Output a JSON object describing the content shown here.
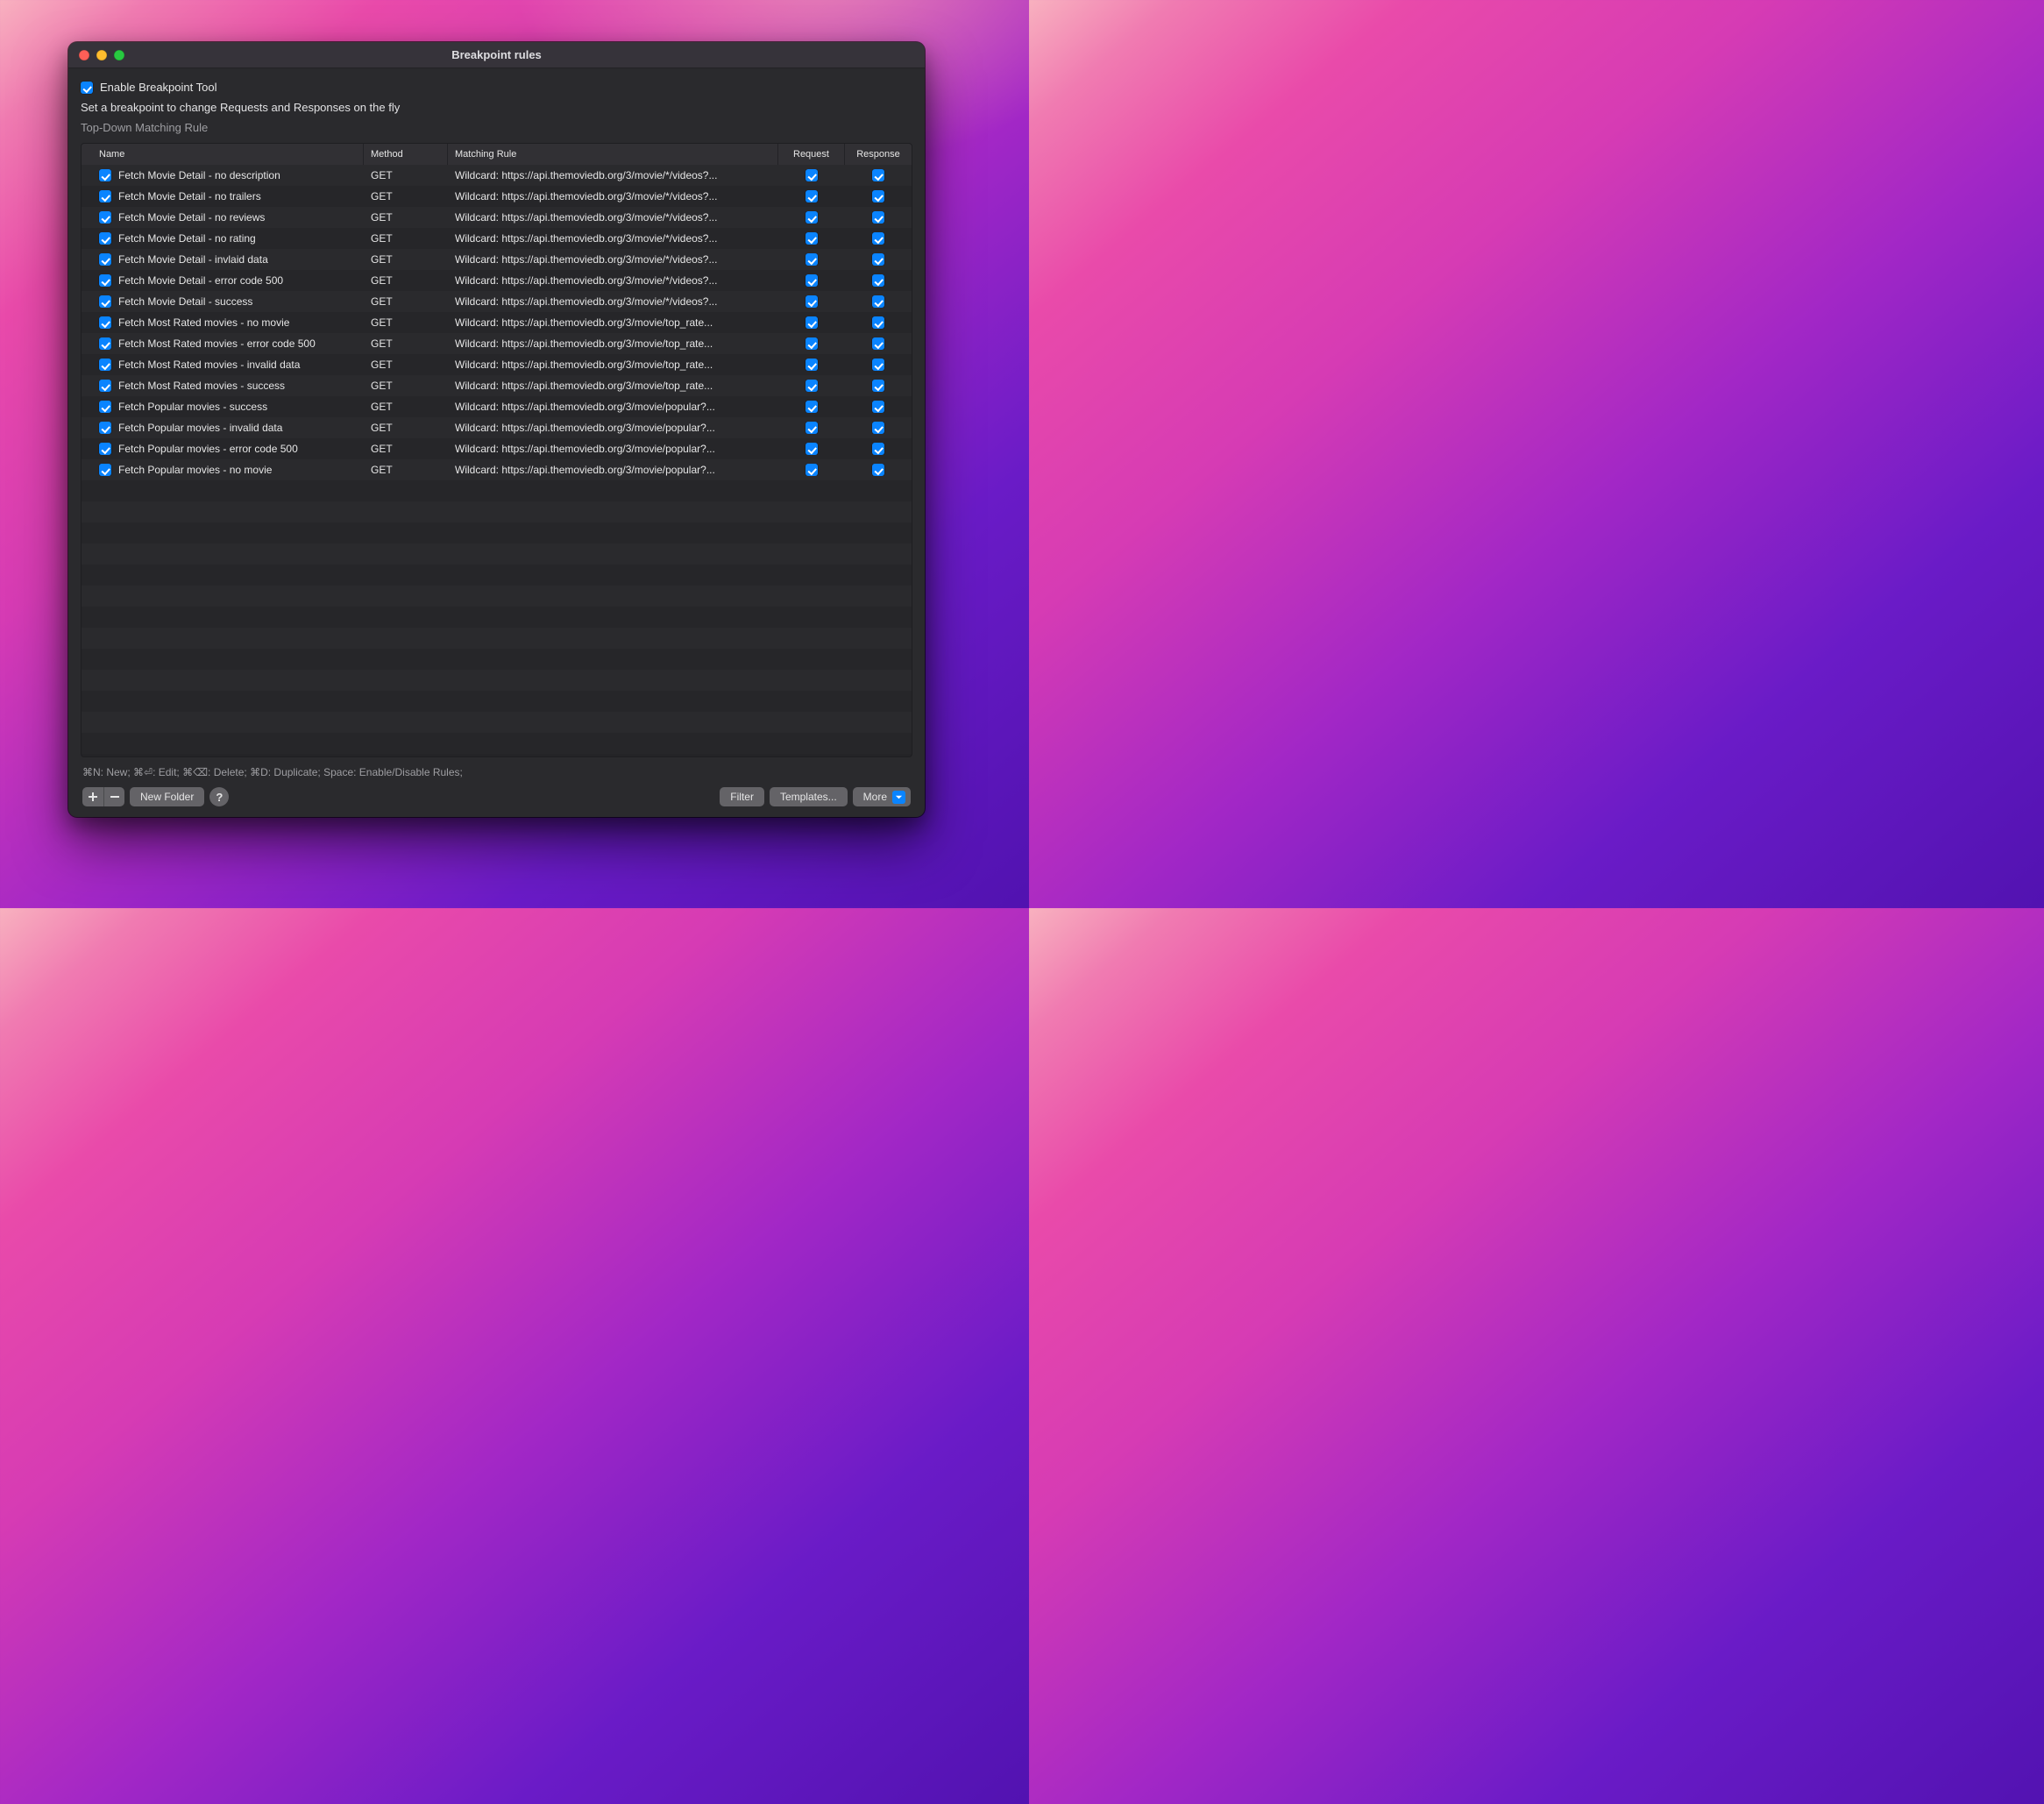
{
  "window": {
    "title": "Breakpoint rules"
  },
  "header": {
    "enable_label": "Enable Breakpoint Tool",
    "enable_checked": true,
    "subtitle": "Set a breakpoint to change Requests and Responses on the fly",
    "matching": "Top-Down Matching Rule"
  },
  "columns": {
    "name": "Name",
    "method": "Method",
    "rule": "Matching Rule",
    "request": "Request",
    "response": "Response"
  },
  "rows": [
    {
      "enabled": true,
      "name": "Fetch Movie Detail - no description",
      "method": "GET",
      "rule": "Wildcard: https://api.themoviedb.org/3/movie/*/videos?...",
      "request": true,
      "response": true
    },
    {
      "enabled": true,
      "name": "Fetch Movie Detail - no trailers",
      "method": "GET",
      "rule": "Wildcard: https://api.themoviedb.org/3/movie/*/videos?...",
      "request": true,
      "response": true
    },
    {
      "enabled": true,
      "name": "Fetch Movie Detail - no reviews",
      "method": "GET",
      "rule": "Wildcard: https://api.themoviedb.org/3/movie/*/videos?...",
      "request": true,
      "response": true
    },
    {
      "enabled": true,
      "name": "Fetch Movie Detail - no rating",
      "method": "GET",
      "rule": "Wildcard: https://api.themoviedb.org/3/movie/*/videos?...",
      "request": true,
      "response": true
    },
    {
      "enabled": true,
      "name": "Fetch Movie Detail - invlaid data",
      "method": "GET",
      "rule": "Wildcard: https://api.themoviedb.org/3/movie/*/videos?...",
      "request": true,
      "response": true
    },
    {
      "enabled": true,
      "name": "Fetch Movie Detail - error code 500",
      "method": "GET",
      "rule": "Wildcard: https://api.themoviedb.org/3/movie/*/videos?...",
      "request": true,
      "response": true
    },
    {
      "enabled": true,
      "name": "Fetch Movie Detail - success",
      "method": "GET",
      "rule": "Wildcard: https://api.themoviedb.org/3/movie/*/videos?...",
      "request": true,
      "response": true
    },
    {
      "enabled": true,
      "name": "Fetch Most Rated movies - no movie",
      "method": "GET",
      "rule": "Wildcard: https://api.themoviedb.org/3/movie/top_rate...",
      "request": true,
      "response": true
    },
    {
      "enabled": true,
      "name": "Fetch Most Rated movies - error code 500",
      "method": "GET",
      "rule": "Wildcard: https://api.themoviedb.org/3/movie/top_rate...",
      "request": true,
      "response": true
    },
    {
      "enabled": true,
      "name": "Fetch Most Rated movies - invalid data",
      "method": "GET",
      "rule": "Wildcard: https://api.themoviedb.org/3/movie/top_rate...",
      "request": true,
      "response": true
    },
    {
      "enabled": true,
      "name": "Fetch Most Rated movies - success",
      "method": "GET",
      "rule": "Wildcard: https://api.themoviedb.org/3/movie/top_rate...",
      "request": true,
      "response": true
    },
    {
      "enabled": true,
      "name": "Fetch Popular movies - success",
      "method": "GET",
      "rule": "Wildcard: https://api.themoviedb.org/3/movie/popular?...",
      "request": true,
      "response": true
    },
    {
      "enabled": true,
      "name": "Fetch Popular movies - invalid data",
      "method": "GET",
      "rule": "Wildcard: https://api.themoviedb.org/3/movie/popular?...",
      "request": true,
      "response": true
    },
    {
      "enabled": true,
      "name": "Fetch Popular movies - error code 500",
      "method": "GET",
      "rule": "Wildcard: https://api.themoviedb.org/3/movie/popular?...",
      "request": true,
      "response": true
    },
    {
      "enabled": true,
      "name": "Fetch Popular movies - no movie",
      "method": "GET",
      "rule": "Wildcard: https://api.themoviedb.org/3/movie/popular?...",
      "request": true,
      "response": true
    }
  ],
  "empty_row_count": 13,
  "hint": "⌘N: New; ⌘⏎: Edit; ⌘⌫: Delete; ⌘D: Duplicate; Space: Enable/Disable Rules;",
  "footer": {
    "new_folder": "New Folder",
    "filter": "Filter",
    "templates": "Templates...",
    "more": "More"
  }
}
